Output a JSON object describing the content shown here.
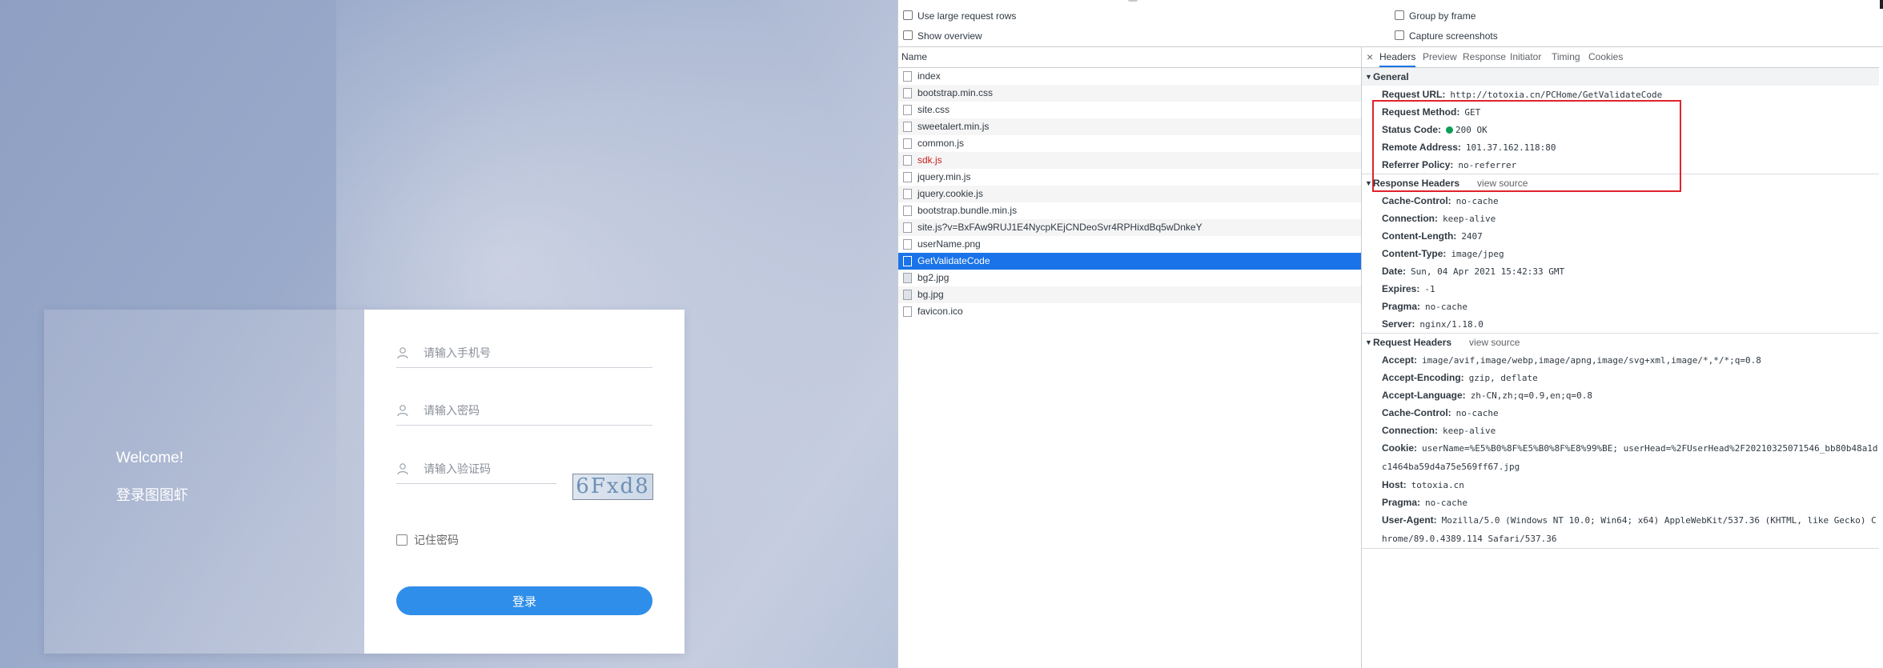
{
  "login": {
    "welcome_title": "Welcome!",
    "welcome_subtitle": "登录图图虾",
    "phone_placeholder": "请输入手机号",
    "password_placeholder": "请输入密码",
    "captcha_placeholder": "请输入验证码",
    "captcha_text": "6Fxd8",
    "remember_label": "记住密码",
    "login_button": "登录"
  },
  "devtools": {
    "options": {
      "large_rows": "Use large request rows",
      "show_overview": "Show overview",
      "group_by_frame": "Group by frame",
      "capture_screenshots": "Capture screenshots"
    },
    "name_header": "Name",
    "requests": [
      {
        "name": "index"
      },
      {
        "name": "bootstrap.min.css"
      },
      {
        "name": "site.css"
      },
      {
        "name": "sweetalert.min.js"
      },
      {
        "name": "common.js"
      },
      {
        "name": "sdk.js"
      },
      {
        "name": "jquery.min.js"
      },
      {
        "name": "jquery.cookie.js"
      },
      {
        "name": "bootstrap.bundle.min.js"
      },
      {
        "name": "site.js?v=BxFAw9RUJ1E4NycpKEjCNDeoSvr4RPHixdBq5wDnkeY"
      },
      {
        "name": "userName.png"
      },
      {
        "name": "GetValidateCode"
      },
      {
        "name": "bg2.jpg"
      },
      {
        "name": "bg.jpg"
      },
      {
        "name": "favicon.ico"
      }
    ],
    "tabs": {
      "close": "×",
      "headers": "Headers",
      "preview": "Preview",
      "response": "Response",
      "initiator": "Initiator",
      "timing": "Timing",
      "cookies": "Cookies"
    },
    "general": {
      "title": "General",
      "request_url_k": "Request URL:",
      "request_url_v": "http://totoxia.cn/PCHome/GetValidateCode",
      "method_k": "Request Method:",
      "method_v": "GET",
      "status_k": "Status Code:",
      "status_v": "200 OK",
      "remote_k": "Remote Address:",
      "remote_v": "101.37.162.118:80",
      "referrer_k": "Referrer Policy:",
      "referrer_v": "no-referrer"
    },
    "response_headers": {
      "title": "Response Headers",
      "view_source": "view source",
      "items": [
        {
          "k": "Cache-Control:",
          "v": "no-cache"
        },
        {
          "k": "Connection:",
          "v": "keep-alive"
        },
        {
          "k": "Content-Length:",
          "v": "2407"
        },
        {
          "k": "Content-Type:",
          "v": "image/jpeg"
        },
        {
          "k": "Date:",
          "v": "Sun, 04 Apr 2021 15:42:33 GMT"
        },
        {
          "k": "Expires:",
          "v": "-1"
        },
        {
          "k": "Pragma:",
          "v": "no-cache"
        },
        {
          "k": "Server:",
          "v": "nginx/1.18.0"
        }
      ]
    },
    "request_headers": {
      "title": "Request Headers",
      "view_source": "view source",
      "items": [
        {
          "k": "Accept:",
          "v": "image/avif,image/webp,image/apng,image/svg+xml,image/*,*/*;q=0.8"
        },
        {
          "k": "Accept-Encoding:",
          "v": "gzip, deflate"
        },
        {
          "k": "Accept-Language:",
          "v": "zh-CN,zh;q=0.9,en;q=0.8"
        },
        {
          "k": "Cache-Control:",
          "v": "no-cache"
        },
        {
          "k": "Connection:",
          "v": "keep-alive"
        },
        {
          "k": "Cookie:",
          "v": "userName=%E5%B0%8F%E5%B0%8F%E8%99%BE; userHead=%2FUserHead%2F20210325071546_bb80b48a1dc1464ba59d4a75e569ff67.jpg"
        },
        {
          "k": "Host:",
          "v": "totoxia.cn"
        },
        {
          "k": "Pragma:",
          "v": "no-cache"
        },
        {
          "k": "User-Agent:",
          "v": "Mozilla/5.0 (Windows NT 10.0; Win64; x64) AppleWebKit/537.36 (KHTML, like Gecko) Chrome/89.0.4389.114 Safari/537.36"
        }
      ]
    }
  }
}
